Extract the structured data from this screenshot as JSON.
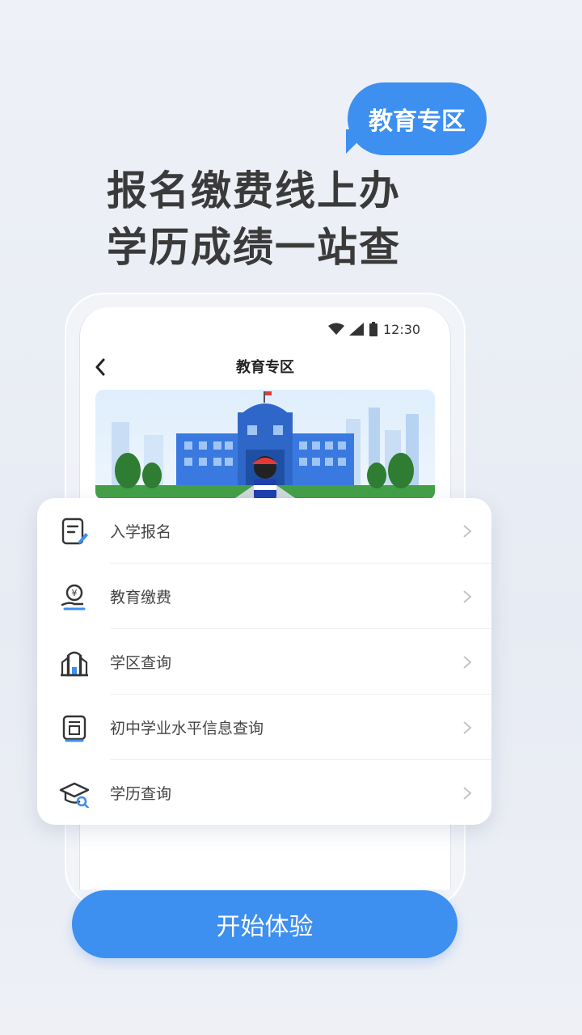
{
  "bubble": {
    "label": "教育专区"
  },
  "headline": {
    "line1": "报名缴费线上办",
    "line2": "学历成绩一站查"
  },
  "phone": {
    "status_time": "12:30",
    "nav_title": "教育专区"
  },
  "menu": {
    "items": [
      {
        "label": "入学报名",
        "icon": "form-edit-icon"
      },
      {
        "label": "教育缴费",
        "icon": "payment-icon"
      },
      {
        "label": "学区查询",
        "icon": "school-building-icon"
      },
      {
        "label": "初中学业水平信息查询",
        "icon": "report-card-icon"
      },
      {
        "label": "学历查询",
        "icon": "graduation-cap-search-icon"
      }
    ]
  },
  "cta": {
    "label": "开始体验"
  },
  "colors": {
    "accent": "#3d8ff0"
  }
}
